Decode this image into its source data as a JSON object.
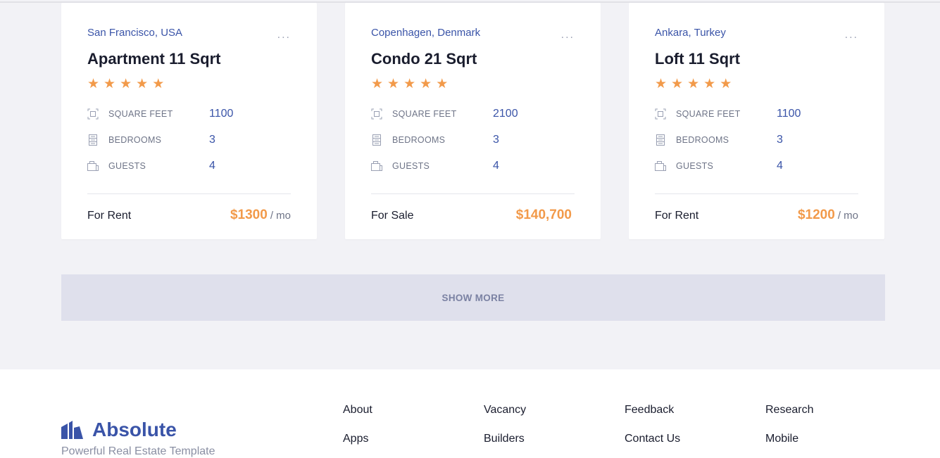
{
  "listings": [
    {
      "location": "San Francisco, USA",
      "more": "...",
      "title": "Apartment 11 Sqrt",
      "rating": 5,
      "specs": [
        {
          "icon": "square-feet-icon",
          "label": "SQUARE FEET",
          "value": "1100"
        },
        {
          "icon": "bedrooms-icon",
          "label": "BEDROOMS",
          "value": "3"
        },
        {
          "icon": "guests-icon",
          "label": "GUESTS",
          "value": "4"
        }
      ],
      "status": "For Rent",
      "price": "$1300",
      "per": "/ mo"
    },
    {
      "location": "Copenhagen, Denmark",
      "more": "...",
      "title": "Condo 21 Sqrt",
      "rating": 5,
      "specs": [
        {
          "icon": "square-feet-icon",
          "label": "SQUARE FEET",
          "value": "2100"
        },
        {
          "icon": "bedrooms-icon",
          "label": "BEDROOMS",
          "value": "3"
        },
        {
          "icon": "guests-icon",
          "label": "GUESTS",
          "value": "4"
        }
      ],
      "status": "For Sale",
      "price": "$140,700",
      "per": ""
    },
    {
      "location": "Ankara, Turkey",
      "more": "...",
      "title": "Loft 11 Sqrt",
      "rating": 5,
      "specs": [
        {
          "icon": "square-feet-icon",
          "label": "SQUARE FEET",
          "value": "1100"
        },
        {
          "icon": "bedrooms-icon",
          "label": "BEDROOMS",
          "value": "3"
        },
        {
          "icon": "guests-icon",
          "label": "GUESTS",
          "value": "4"
        }
      ],
      "status": "For Rent",
      "price": "$1200",
      "per": "/ mo"
    }
  ],
  "show_more": "SHOW MORE",
  "footer": {
    "brand": "Absolute",
    "tagline": "Powerful Real Estate Template",
    "logo_icon": "building-logo-icon",
    "links": [
      [
        "About",
        "Apps"
      ],
      [
        "Vacancy",
        "Builders"
      ],
      [
        "Feedback",
        "Contact Us"
      ],
      [
        "Research",
        "Mobile"
      ]
    ]
  },
  "colors": {
    "accent": "#3a54a8",
    "price": "#f29a4a",
    "star": "#f29a4a",
    "background": "#f2f2f6",
    "show_more_bg": "#dfe0ec"
  }
}
